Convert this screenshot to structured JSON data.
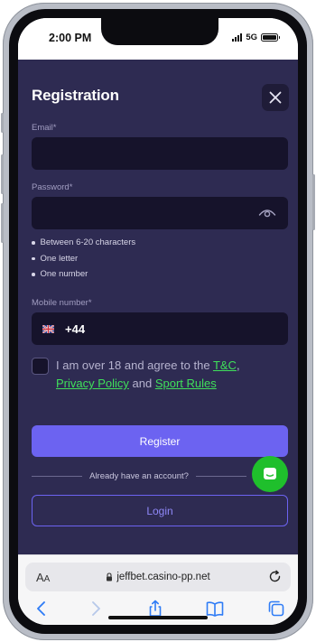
{
  "status_bar": {
    "time": "2:00 PM",
    "network": "5G"
  },
  "registration": {
    "title": "Registration",
    "email": {
      "label": "Email*",
      "value": "",
      "placeholder": ""
    },
    "password": {
      "label": "Password*",
      "value": "",
      "placeholder": "",
      "rules": [
        "Between 6-20 characters",
        "One letter",
        "One number"
      ]
    },
    "mobile": {
      "label": "Mobile number*",
      "country_code": "+44",
      "flag_icon": "uk-flag-icon"
    },
    "consent": {
      "checked": false,
      "text_before": "I am over 18 and agree to the ",
      "tc_link": "T&C",
      "comma": ",",
      "privacy_link": "Privacy Policy",
      "and_text": " and ",
      "sport_rules_link": "Sport Rules"
    },
    "register_label": "Register",
    "divider_text": "Already have an account?",
    "login_label": "Login"
  },
  "browser": {
    "aa_label": "A",
    "aa_small": "A",
    "url": "jeffbet.casino-pp.net"
  },
  "colors": {
    "modal_bg": "#2e2b52",
    "input_bg": "#16132b",
    "accent": "#6c63f1",
    "link_green": "#3fe05a",
    "chat_green": "#1fbf2c"
  }
}
